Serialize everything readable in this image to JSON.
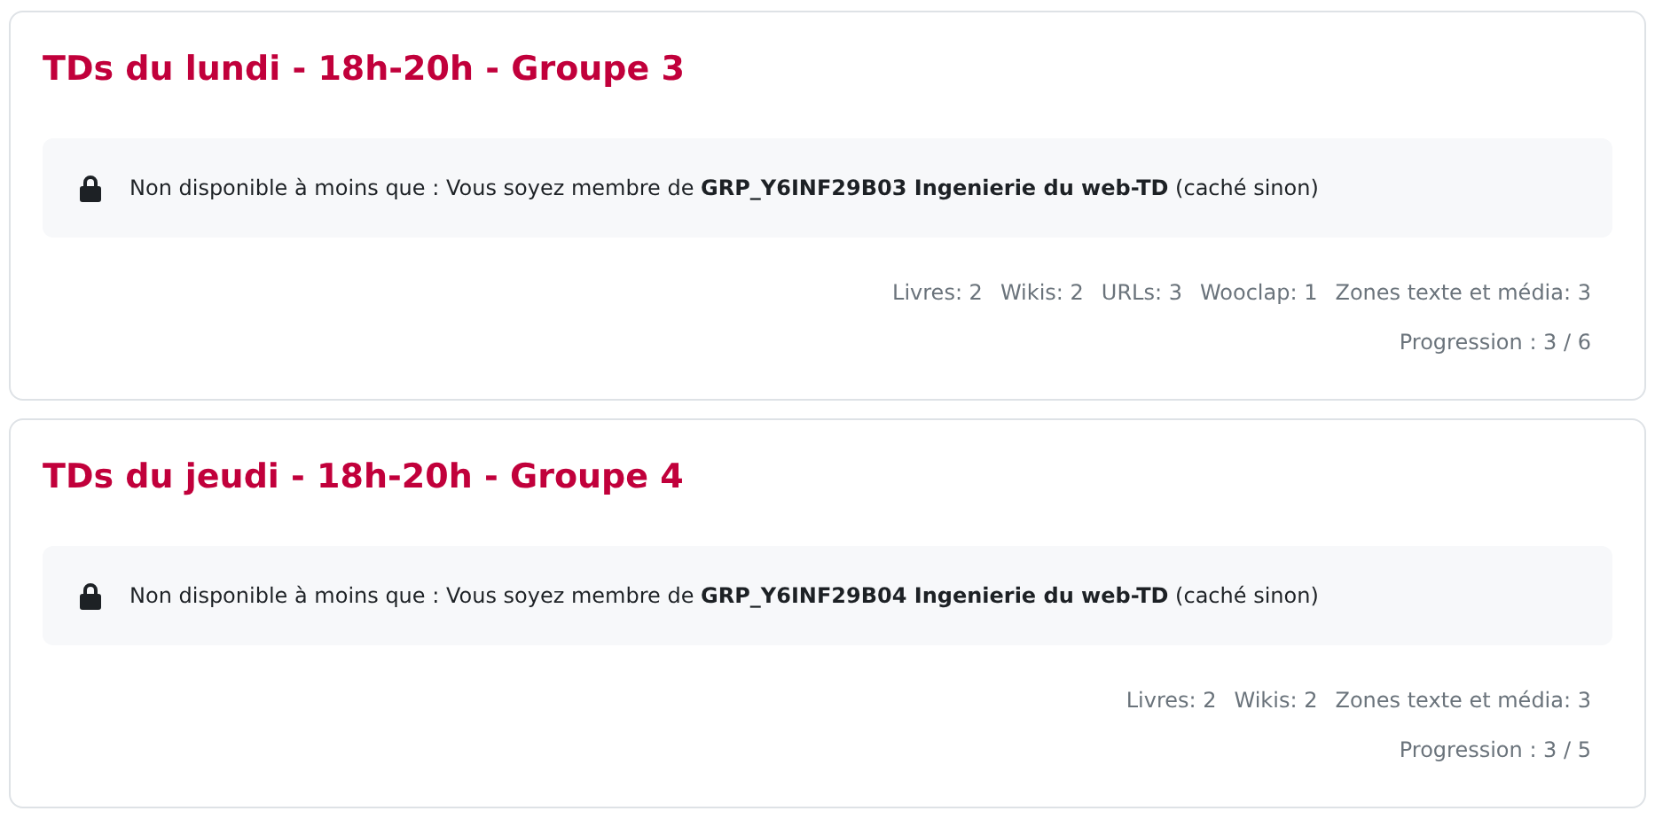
{
  "sections": [
    {
      "title": "TDs du lundi - 18h-20h - Groupe 3",
      "restriction": "Non disponible à moins que : Vous soyez membre de **GRP_Y6INF29B03 Ingenierie du web-TD** (caché sinon)",
      "activities": [
        "Livres: 2",
        "Wikis: 2",
        "URLs: 3",
        "Wooclap: 1",
        "Zones texte et média: 3"
      ],
      "progress": "Progression : 3 / 6"
    },
    {
      "title": "TDs du jeudi - 18h-20h - Groupe 4",
      "restriction": "Non disponible à moins que : Vous soyez membre de **GRP_Y6INF29B04 Ingenierie du web-TD** (caché sinon)",
      "activities": [
        "Livres: 2",
        "Wikis: 2",
        "Zones texte et média: 3"
      ],
      "progress": "Progression : 3 / 5"
    }
  ]
}
